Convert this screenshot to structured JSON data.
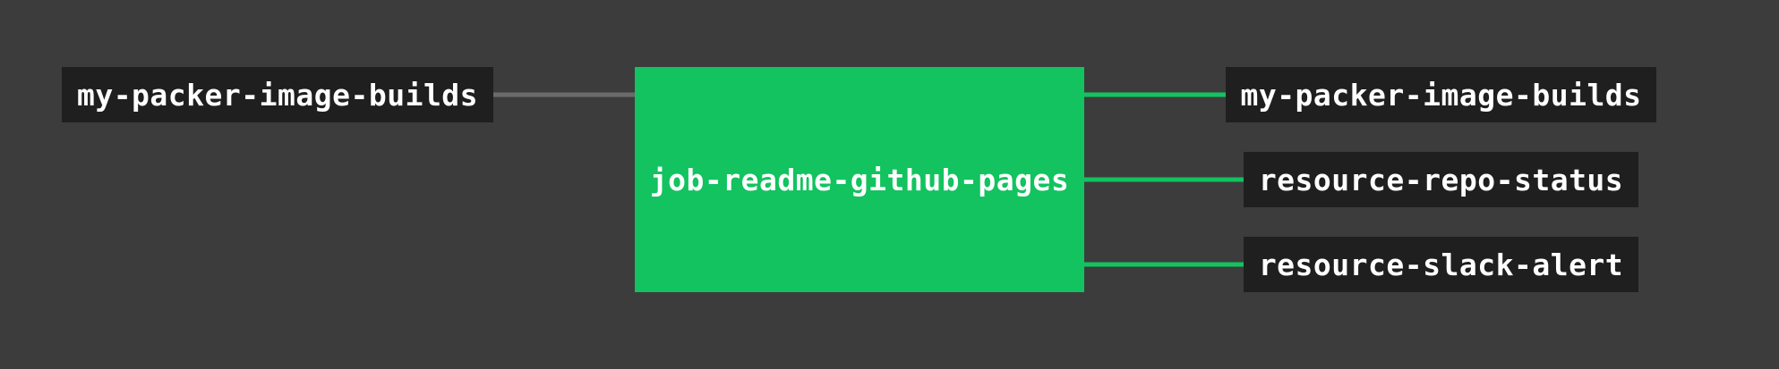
{
  "pipeline": {
    "inputs": [
      {
        "label": "my-packer-image-builds",
        "status": "not-triggering"
      }
    ],
    "job": {
      "label": "job-readme-github-pages",
      "status": "succeeded"
    },
    "outputs": [
      {
        "label": "my-packer-image-builds"
      },
      {
        "label": "resource-repo-status"
      },
      {
        "label": "resource-slack-alert"
      }
    ]
  },
  "colors": {
    "background": "#3c3c3c",
    "resource_box": "#1f1f1f",
    "job_succeeded": "#12c35f",
    "edge_active": "#12c35f",
    "edge_inactive": "#6b6b6b",
    "text": "#ffffff"
  }
}
